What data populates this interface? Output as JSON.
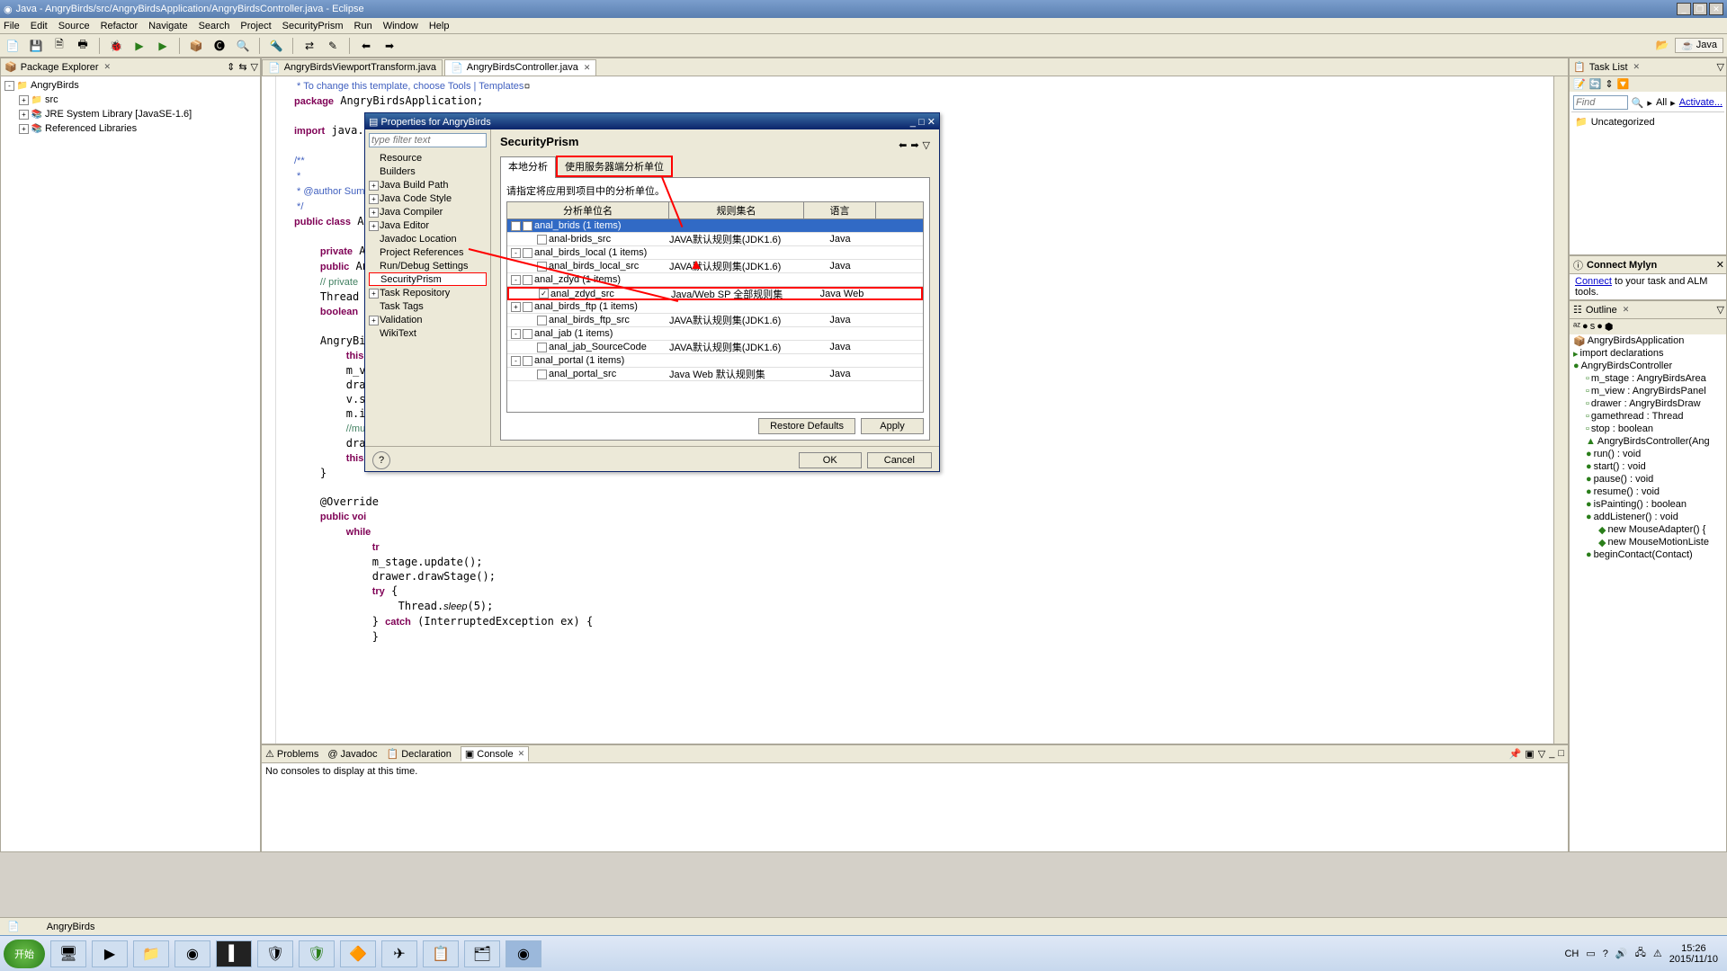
{
  "window": {
    "title": "Java - AngryBirds/src/AngryBirdsApplication/AngryBirdsController.java - Eclipse"
  },
  "menubar": [
    "File",
    "Edit",
    "Source",
    "Refactor",
    "Navigate",
    "Search",
    "Project",
    "SecurityPrism",
    "Run",
    "Window",
    "Help"
  ],
  "perspective": "Java",
  "package_explorer": {
    "title": "Package Explorer",
    "items": [
      {
        "exp": "-",
        "icon": "📁",
        "label": "AngryBirds",
        "indent": 0
      },
      {
        "exp": "+",
        "icon": "📁",
        "label": "src",
        "indent": 1
      },
      {
        "exp": "+",
        "icon": "📚",
        "label": "JRE System Library [JavaSE-1.6]",
        "indent": 1
      },
      {
        "exp": "+",
        "icon": "📚",
        "label": "Referenced Libraries",
        "indent": 1
      }
    ]
  },
  "editor": {
    "tabs": [
      {
        "icon": "📄",
        "label": "AngryBirdsViewportTransform.java",
        "active": false
      },
      {
        "icon": "📄",
        "label": "AngryBirdsController.java",
        "active": true
      }
    ]
  },
  "bottom": {
    "tabs": [
      "Problems",
      "Javadoc",
      "Declaration",
      "Console"
    ],
    "active": "Console",
    "console_msg": "No consoles to display at this time."
  },
  "tasklist": {
    "title": "Task List",
    "find_placeholder": "Find",
    "all": "All",
    "activate": "Activate...",
    "uncategorized": "Uncategorized"
  },
  "mylyn": {
    "title": "Connect Mylyn",
    "text1": "Connect",
    "text2": " to your task and ALM tools."
  },
  "outline": {
    "title": "Outline",
    "items": [
      {
        "ic": "📦",
        "label": "AngryBirdsApplication",
        "indent": 0
      },
      {
        "ic": "▸",
        "label": "import declarations",
        "indent": 0
      },
      {
        "ic": "●",
        "label": "AngryBirdsController",
        "indent": 0
      },
      {
        "ic": "▫",
        "label": "m_stage : AngryBirdsArea",
        "indent": 1
      },
      {
        "ic": "▫",
        "label": "m_view : AngryBirdsPanel",
        "indent": 1
      },
      {
        "ic": "▫",
        "label": "drawer : AngryBirdsDraw",
        "indent": 1
      },
      {
        "ic": "▫",
        "label": "gamethread : Thread",
        "indent": 1
      },
      {
        "ic": "▫",
        "label": "stop : boolean",
        "indent": 1
      },
      {
        "ic": "▲",
        "label": "AngryBirdsController(Ang",
        "indent": 1
      },
      {
        "ic": "●",
        "label": "run() : void",
        "indent": 1
      },
      {
        "ic": "●",
        "label": "start() : void",
        "indent": 1
      },
      {
        "ic": "●",
        "label": "pause() : void",
        "indent": 1
      },
      {
        "ic": "●",
        "label": "resume() : void",
        "indent": 1
      },
      {
        "ic": "●",
        "label": "isPainting() : boolean",
        "indent": 1
      },
      {
        "ic": "●",
        "label": "addListener() : void",
        "indent": 1
      },
      {
        "ic": "◆",
        "label": "new MouseAdapter() {",
        "indent": 2
      },
      {
        "ic": "◆",
        "label": "new MouseMotionListe",
        "indent": 2
      },
      {
        "ic": "●",
        "label": "beginContact(Contact)",
        "indent": 1
      }
    ]
  },
  "dialog": {
    "title": "Properties for AngryBirds",
    "filter_placeholder": "type filter text",
    "tree": [
      {
        "exp": "",
        "label": "Resource",
        "indent": 1
      },
      {
        "exp": "",
        "label": "Builders",
        "indent": 1
      },
      {
        "exp": "+",
        "label": "Java Build Path",
        "indent": 1
      },
      {
        "exp": "+",
        "label": "Java Code Style",
        "indent": 1
      },
      {
        "exp": "+",
        "label": "Java Compiler",
        "indent": 1
      },
      {
        "exp": "+",
        "label": "Java Editor",
        "indent": 1
      },
      {
        "exp": "",
        "label": "Javadoc Location",
        "indent": 1
      },
      {
        "exp": "",
        "label": "Project References",
        "indent": 1
      },
      {
        "exp": "",
        "label": "Run/Debug Settings",
        "indent": 1
      },
      {
        "exp": "",
        "label": "SecurityPrism",
        "indent": 1,
        "sel": true
      },
      {
        "exp": "+",
        "label": "Task Repository",
        "indent": 1
      },
      {
        "exp": "",
        "label": "Task Tags",
        "indent": 1
      },
      {
        "exp": "+",
        "label": "Validation",
        "indent": 1
      },
      {
        "exp": "",
        "label": "WikiText",
        "indent": 1
      }
    ],
    "heading": "SecurityPrism",
    "tab1": "本地分析",
    "tab2": "使用服务器端分析单位",
    "instruction": "请指定将应用到项目中的分析单位。",
    "col1": "分析单位名",
    "col2": "规则集名",
    "col3": "语言",
    "rows": [
      {
        "indent": 0,
        "exp": "-",
        "cb": "checked",
        "label": "anal_brids (1 items)",
        "c2": "",
        "c3": "",
        "sel": true
      },
      {
        "indent": 1,
        "exp": "",
        "cb": "",
        "label": "anal-brids_src",
        "c2": "JAVA默认规则集(JDK1.6)",
        "c3": "Java"
      },
      {
        "indent": 0,
        "exp": "-",
        "cb": "",
        "label": "anal_birds_local (1 items)",
        "c2": "",
        "c3": ""
      },
      {
        "indent": 1,
        "exp": "",
        "cb": "",
        "label": "anal_birds_local_src",
        "c2": "JAVA默认规则集(JDK1.6)",
        "c3": "Java"
      },
      {
        "indent": 0,
        "exp": "-",
        "cb": "",
        "label": "anal_zdyd (1 items)",
        "c2": "",
        "c3": ""
      },
      {
        "indent": 1,
        "exp": "",
        "cb": "checked",
        "label": "anal_zdyd_src",
        "c2": "Java/Web SP 全部规则集",
        "c3": "Java Web",
        "hl": true
      },
      {
        "indent": 0,
        "exp": "+",
        "cb": "",
        "label": "anal_birds_ftp (1 items)",
        "c2": "",
        "c3": ""
      },
      {
        "indent": 1,
        "exp": "",
        "cb": "",
        "label": "anal_birds_ftp_src",
        "c2": "JAVA默认规则集(JDK1.6)",
        "c3": "Java"
      },
      {
        "indent": 0,
        "exp": "-",
        "cb": "",
        "label": "anal_jab (1 items)",
        "c2": "",
        "c3": ""
      },
      {
        "indent": 1,
        "exp": "",
        "cb": "",
        "label": "anal_jab_SourceCode",
        "c2": "JAVA默认规则集(JDK1.6)",
        "c3": "Java"
      },
      {
        "indent": 0,
        "exp": "-",
        "cb": "",
        "label": "anal_portal (1 items)",
        "c2": "",
        "c3": ""
      },
      {
        "indent": 1,
        "exp": "",
        "cb": "",
        "label": "anal_portal_src",
        "c2": "Java Web 默认规则集",
        "c3": "Java"
      }
    ],
    "restore": "Restore Defaults",
    "apply": "Apply",
    "ok": "OK",
    "cancel": "Cancel"
  },
  "status": {
    "project": "AngryBirds"
  },
  "tray": {
    "ime": "CH",
    "time": "15:26",
    "date": "2015/11/10"
  },
  "start_label": "开始"
}
